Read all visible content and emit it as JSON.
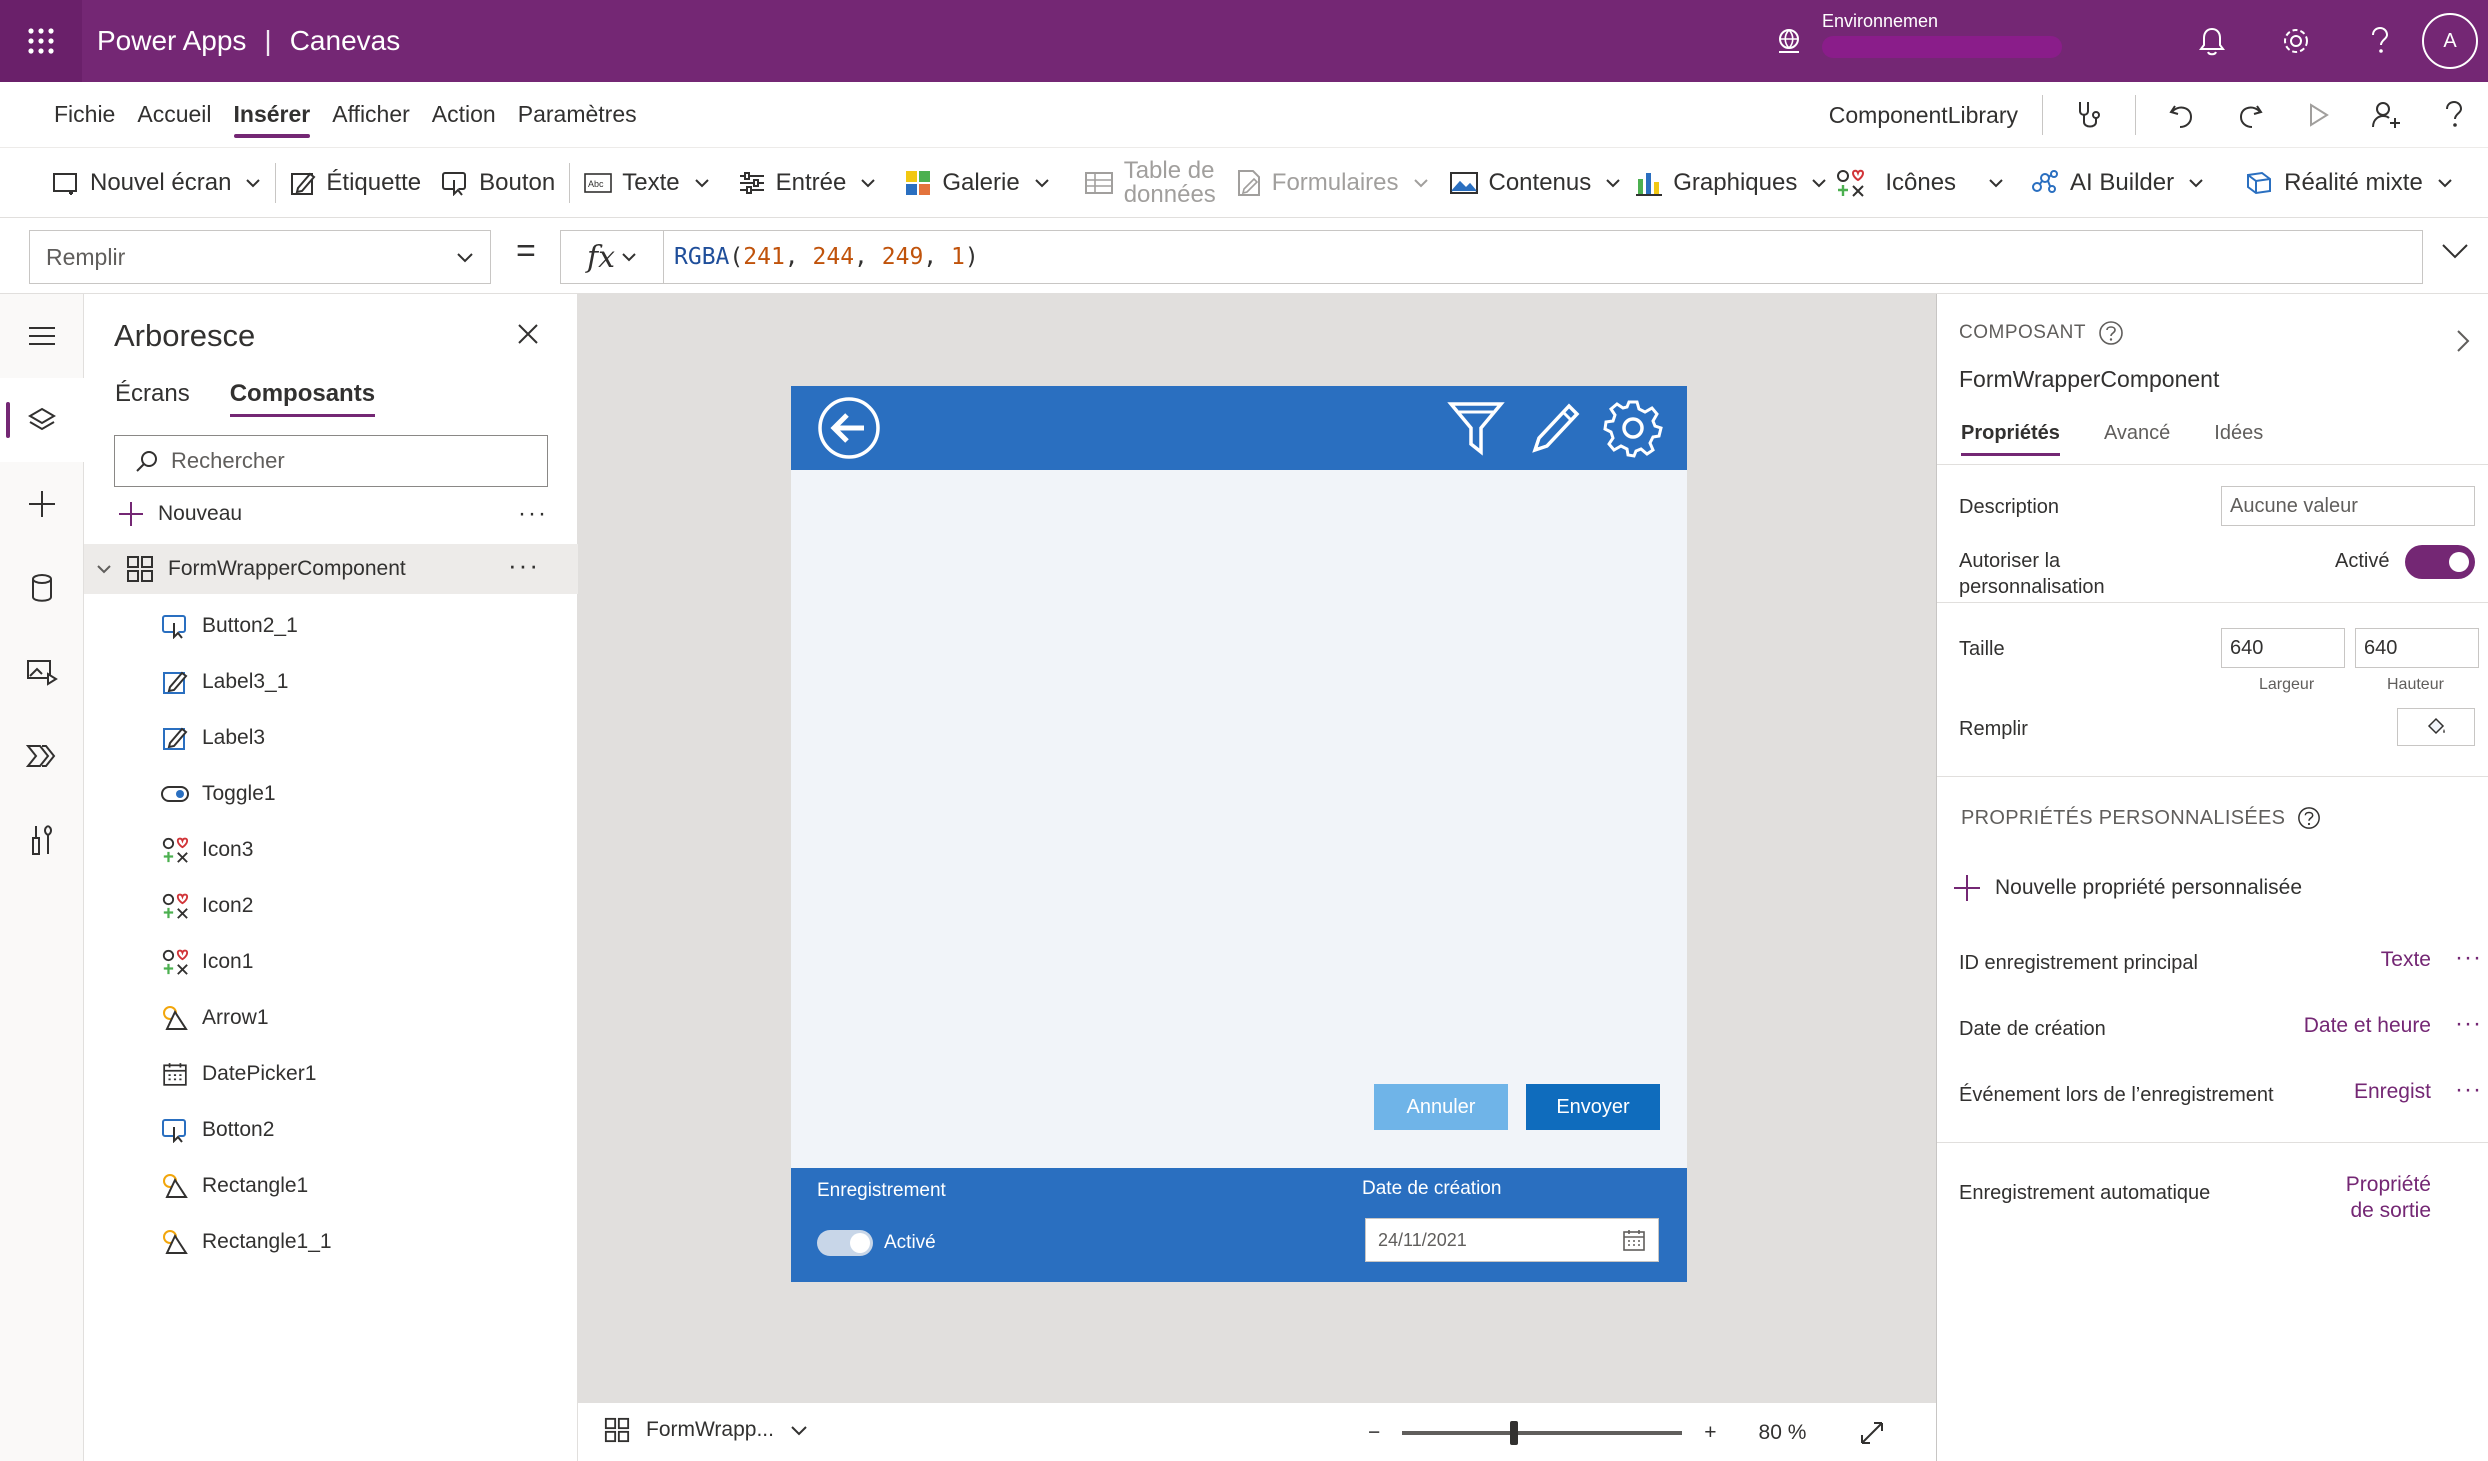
{
  "topbar": {
    "app": "Power Apps",
    "separator": "|",
    "mode": "Canevas",
    "environment_label": "Environnemen",
    "avatar_initial": "A"
  },
  "menu": {
    "items": [
      "Fichie",
      "Accueil",
      "Insérer",
      "Afficher",
      "Action",
      "Paramètres"
    ],
    "active": "Insérer",
    "app_name": "ComponentLibrary"
  },
  "ribbon": {
    "new_screen": "Nouvel écran",
    "label": "Étiquette",
    "button": "Bouton",
    "text": "Texte",
    "input": "Entrée",
    "gallery": "Galerie",
    "data_table_1": "Table de",
    "data_table_2": "données",
    "forms": "Formulaires",
    "media": "Contenus",
    "charts": "Graphiques",
    "icons": "Icônes",
    "ai_builder": "AI Builder",
    "mixed_reality": "Réalité mixte"
  },
  "formula": {
    "property": "Remplir",
    "equals": "=",
    "fx": "fx",
    "fn": "RGBA",
    "open": "(",
    "a": "241",
    "b": "244",
    "c": "249",
    "d": "1",
    "comma": ", ",
    "close": ")"
  },
  "tree": {
    "title": "Arboresce",
    "tabs": [
      "Écrans",
      "Composants"
    ],
    "active_tab": "Composants",
    "search_placeholder": "Rechercher",
    "new_label": "Nouveau",
    "more": "···",
    "component": "FormWrapperComponent",
    "children": [
      {
        "name": "Button2_1",
        "icon": "button-icon"
      },
      {
        "name": "Label3_1",
        "icon": "label-edit-icon"
      },
      {
        "name": "Label3",
        "icon": "label-edit-icon"
      },
      {
        "name": "Toggle1",
        "icon": "toggle-icon"
      },
      {
        "name": "Icon3",
        "icon": "icons-icon"
      },
      {
        "name": "Icon2",
        "icon": "icons-icon"
      },
      {
        "name": "Icon1",
        "icon": "icons-icon"
      },
      {
        "name": "Arrow1",
        "icon": "shape-icon"
      },
      {
        "name": "DatePicker1",
        "icon": "calendar-icon"
      },
      {
        "name": "Botton2",
        "icon": "button-icon"
      },
      {
        "name": "Rectangle1",
        "icon": "shape-icon"
      },
      {
        "name": "Rectangle1_1",
        "icon": "shape-icon"
      }
    ]
  },
  "canvas": {
    "cancel": "Annuler",
    "send": "Envoyer",
    "footer_record": "Enregistrement",
    "footer_toggle": "Activé",
    "footer_date_label": "Date de création",
    "footer_date": "24/11/2021",
    "screen_bg": "#f1f4f9",
    "header_color": "#2a6fc0"
  },
  "statusbar": {
    "screen": "FormWrapp...",
    "zoom_minus": "−",
    "zoom_plus": "+",
    "zoom": "80 %",
    "zoom_level": 0.4
  },
  "properties": {
    "header": "COMPOSANT",
    "name": "FormWrapperComponent",
    "tabs": [
      "Propriétés",
      "Avancé",
      "Idées"
    ],
    "active_tab": "Propriétés",
    "description_label": "Description",
    "description_value": "Aucune valeur",
    "allow_custom_1": "Autoriser la",
    "allow_custom_2": "personnalisation",
    "allow_custom_state": "Activé",
    "size_label": "Taille",
    "width": "640",
    "height": "640",
    "width_label": "Largeur",
    "height_label": "Hauteur",
    "fill_label": "Remplir",
    "custom_header": "PROPRIÉTÉS PERSONNALISÉES",
    "new_custom": "Nouvelle propriété personnalisée",
    "custom": [
      {
        "name": "ID enregistrement principal",
        "type": "Texte"
      },
      {
        "name": "Date de création",
        "type": "Date et heure"
      },
      {
        "name": "Événement lors de l’enregistrement",
        "type": "Enregist"
      }
    ],
    "auto_save": "Enregistrement automatique",
    "auto_save_type_1": "Propriété",
    "auto_save_type_2": "de sortie",
    "dots": "···"
  },
  "colors": {
    "brand": "#742774",
    "header_blue": "#2a6fc0"
  }
}
